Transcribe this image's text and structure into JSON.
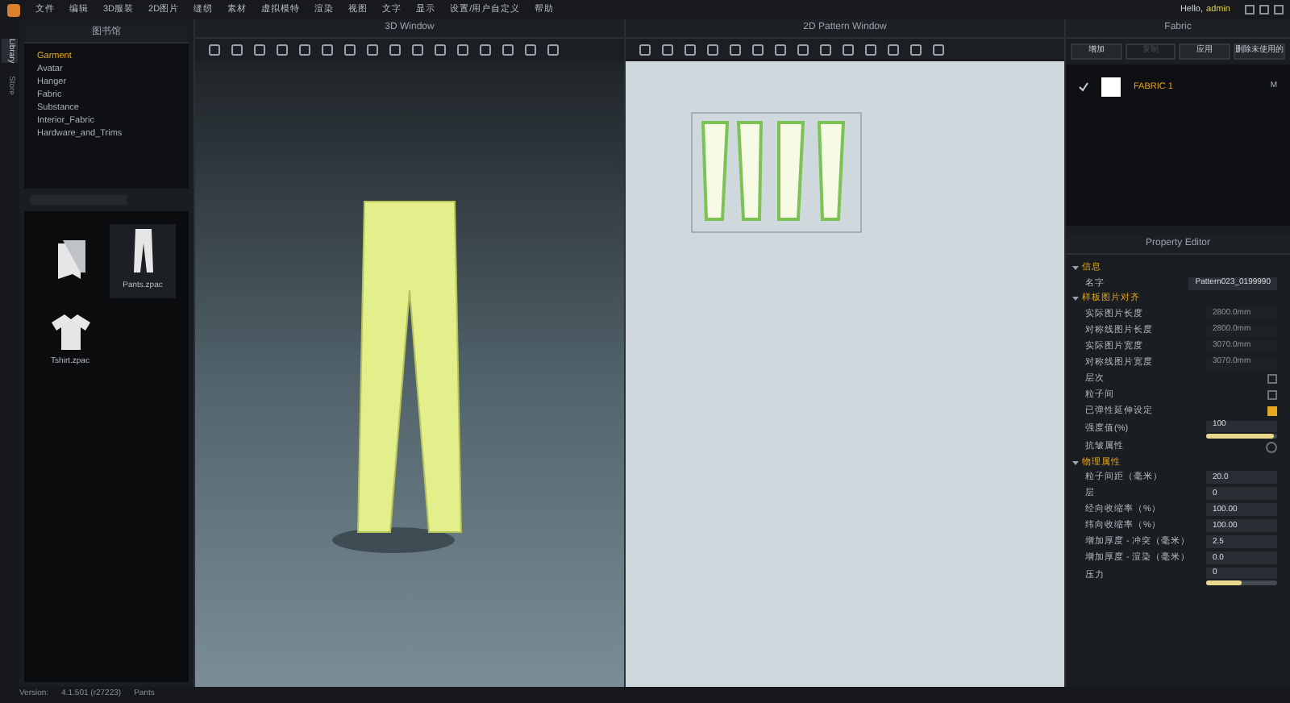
{
  "menu": [
    "文件",
    "编辑",
    "3D服装",
    "2D图片",
    "缝纫",
    "素材",
    "虚拟模特",
    "渲染",
    "视图",
    "文字",
    "显示",
    "设置/用户自定义",
    "帮助"
  ],
  "user": {
    "greeting": "Hello,",
    "name": "admin"
  },
  "side_tabs": [
    {
      "label": "Library",
      "selected": true
    },
    {
      "label": "Store",
      "selected": false
    }
  ],
  "library": {
    "title": "图书馆",
    "items": [
      {
        "label": "Garment",
        "selected": true
      },
      {
        "label": "Avatar",
        "selected": false
      },
      {
        "label": "Hanger",
        "selected": false
      },
      {
        "label": "Fabric",
        "selected": false
      },
      {
        "label": "Substance",
        "selected": false
      },
      {
        "label": "Interior_Fabric",
        "selected": false
      },
      {
        "label": "Hardware_and_Trims",
        "selected": false
      }
    ],
    "files": [
      {
        "kind": "folder",
        "selected": false
      },
      {
        "kind": "pants",
        "label": "Pants.zpac",
        "selected": true
      },
      {
        "kind": "shirt",
        "label": "Tshirt.zpac",
        "selected": false
      }
    ]
  },
  "window_3d": {
    "title": "3D Window"
  },
  "window_2d": {
    "title": "2D Pattern Window"
  },
  "fabric": {
    "title": "Fabric",
    "buttons": [
      {
        "label": "增加",
        "disabled": false
      },
      {
        "label": "复制",
        "disabled": true
      },
      {
        "label": "应用",
        "disabled": false
      },
      {
        "label": "删除未使用的",
        "disabled": false
      }
    ],
    "items": [
      {
        "name": "FABRIC 1",
        "checked": true,
        "badge": "M"
      }
    ]
  },
  "property_editor": {
    "title": "Property Editor",
    "sections": [
      {
        "title": "信息",
        "rows": [
          {
            "kind": "field",
            "label": "名字",
            "value": "Pattern023_0199990"
          }
        ]
      },
      {
        "title": "样板图片对齐",
        "rows": [
          {
            "kind": "field",
            "label": "实际图片长度",
            "value": "2800.0mm",
            "disabled": true
          },
          {
            "kind": "field",
            "label": "对称线图片长度",
            "value": "2800.0mm",
            "disabled": true
          },
          {
            "kind": "field",
            "label": "实际图片宽度",
            "value": "3070.0mm",
            "disabled": true
          },
          {
            "kind": "field",
            "label": "对称线图片宽度",
            "value": "3070.0mm",
            "disabled": true
          },
          {
            "kind": "check",
            "label": "层次",
            "checked": false
          },
          {
            "kind": "check",
            "label": "粒子间",
            "checked": false
          },
          {
            "kind": "check",
            "label": "已弹性延伸设定",
            "checked": true
          },
          {
            "kind": "slider",
            "label": "强度值(%)",
            "value": "100",
            "level": 0.95
          },
          {
            "kind": "radio",
            "label": "抗皱属性",
            "checked": false
          }
        ]
      },
      {
        "title": "物理属性",
        "rows": [
          {
            "kind": "field",
            "label": "粒子间距（毫米）",
            "value": "20.0"
          },
          {
            "kind": "field",
            "label": "层",
            "value": "0"
          },
          {
            "kind": "field",
            "label": "经向收缩率（%）",
            "value": "100.00"
          },
          {
            "kind": "field",
            "label": "纬向收缩率（%）",
            "value": "100.00"
          },
          {
            "kind": "field",
            "label": "增加厚度 - 冲突（毫米）",
            "value": "2.5"
          },
          {
            "kind": "field",
            "label": "增加厚度 - 渲染（毫米）",
            "value": "0.0"
          },
          {
            "kind": "slider",
            "label": "压力",
            "value": "0",
            "level": 0.5
          }
        ]
      }
    ]
  },
  "status_bar": {
    "version_label": "Version:",
    "version": "4.1.501 (r27223)",
    "file": "Pants"
  }
}
